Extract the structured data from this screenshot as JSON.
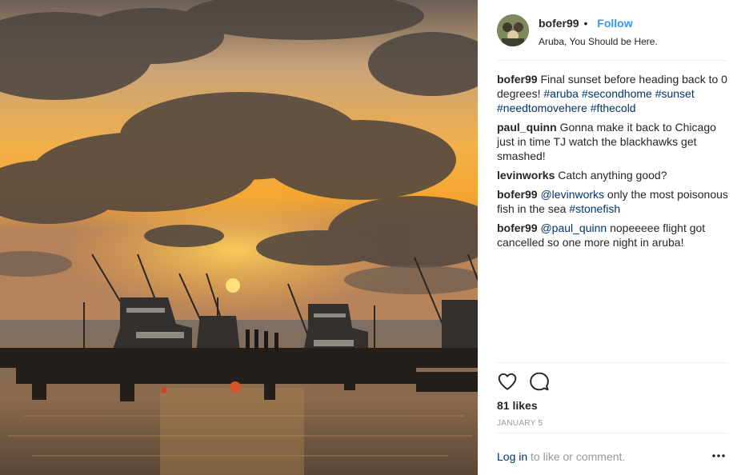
{
  "post": {
    "username": "bofer99",
    "separator": "•",
    "follow_label": "Follow",
    "location": "Aruba, You Should be Here."
  },
  "comments": [
    {
      "user": "bofer99",
      "parts": [
        {
          "t": "Final sunset before heading back to 0 degrees! "
        },
        {
          "t": "#aruba",
          "tag": true
        },
        {
          "t": " "
        },
        {
          "t": "#secondhome",
          "tag": true
        },
        {
          "t": " "
        },
        {
          "t": "#sunset",
          "tag": true
        },
        {
          "t": " "
        },
        {
          "t": "#needtomovehere",
          "tag": true
        },
        {
          "t": " "
        },
        {
          "t": "#fthecold",
          "tag": true
        }
      ]
    },
    {
      "user": "paul_quinn",
      "parts": [
        {
          "t": "Gonna make it back to Chicago just in time TJ watch the blackhawks get smashed!"
        }
      ]
    },
    {
      "user": "levinworks",
      "parts": [
        {
          "t": "Catch anything good?"
        }
      ]
    },
    {
      "user": "bofer99",
      "parts": [
        {
          "t": "@levinworks",
          "tag": true
        },
        {
          "t": " only the most poisonous fish in the sea "
        },
        {
          "t": "#stonefish",
          "tag": true
        }
      ]
    },
    {
      "user": "bofer99",
      "parts": [
        {
          "t": "@paul_quinn",
          "tag": true
        },
        {
          "t": " nopeeeee flight got cancelled so one more night in aruba!"
        }
      ]
    }
  ],
  "stats": {
    "likes": "81 likes",
    "date": "JANUARY 5"
  },
  "footer": {
    "login_link": "Log in",
    "login_suffix": " to like or comment."
  },
  "icons": {
    "like": "heart-icon",
    "comment": "comment-icon",
    "more": "more-options-icon"
  },
  "colors": {
    "link_blue": "#3897f0",
    "tag_blue": "#003569",
    "muted": "#999999",
    "divider": "#efefef"
  }
}
